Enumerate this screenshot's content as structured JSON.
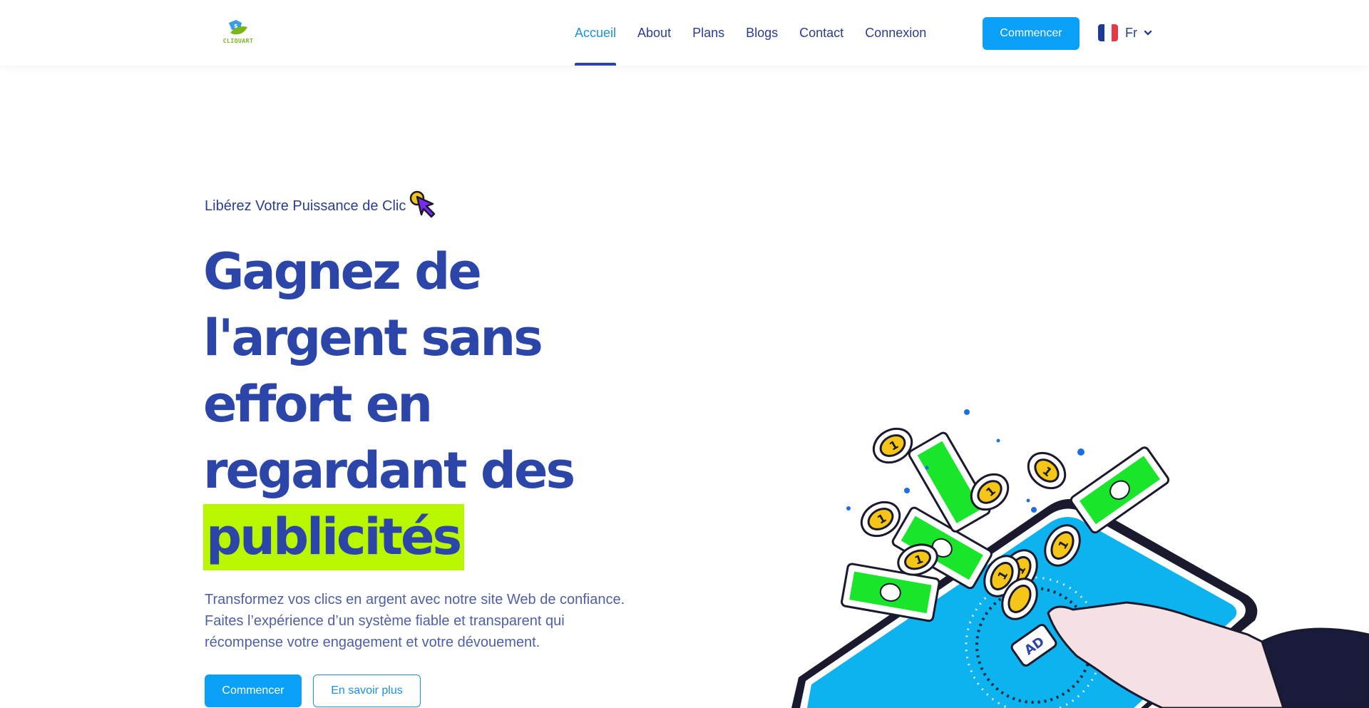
{
  "brand": {
    "name": "CLIQUART"
  },
  "nav": {
    "links": [
      {
        "label": "Accueil",
        "active": true
      },
      {
        "label": "About",
        "active": false
      },
      {
        "label": "Plans",
        "active": false
      },
      {
        "label": "Blogs",
        "active": false
      },
      {
        "label": "Contact",
        "active": false
      },
      {
        "label": "Connexion",
        "active": false
      }
    ],
    "cta_label": "Commencer",
    "language": {
      "label": "Fr",
      "flag": "france-flag-icon"
    }
  },
  "hero": {
    "eyebrow": "Libérez Votre Puissance de Clic",
    "eyebrow_icon": "cursor-click-icon",
    "headline_lines": [
      "Gagnez de",
      "l'argent sans",
      "effort en",
      "regardant des"
    ],
    "headline_highlight": "publicités",
    "description": "Transformez vos clics en argent avec notre site Web de confiance. Faites l’expérience d’un système fiable et transparent qui récompense votre engagement et votre dévouement.",
    "primary_button": "Commencer",
    "secondary_button": "En savoir plus",
    "illustration": {
      "ad_label": "AD",
      "description": "hand tapping ad on phone with coins and bills flying"
    }
  },
  "colors": {
    "primary": "#0aa0f7",
    "heading": "#2b46a8",
    "nav_text": "#2b3d8f",
    "active_nav": "#1b8fe3",
    "highlight": "#b8f700",
    "body_text": "#4f5fa6"
  }
}
